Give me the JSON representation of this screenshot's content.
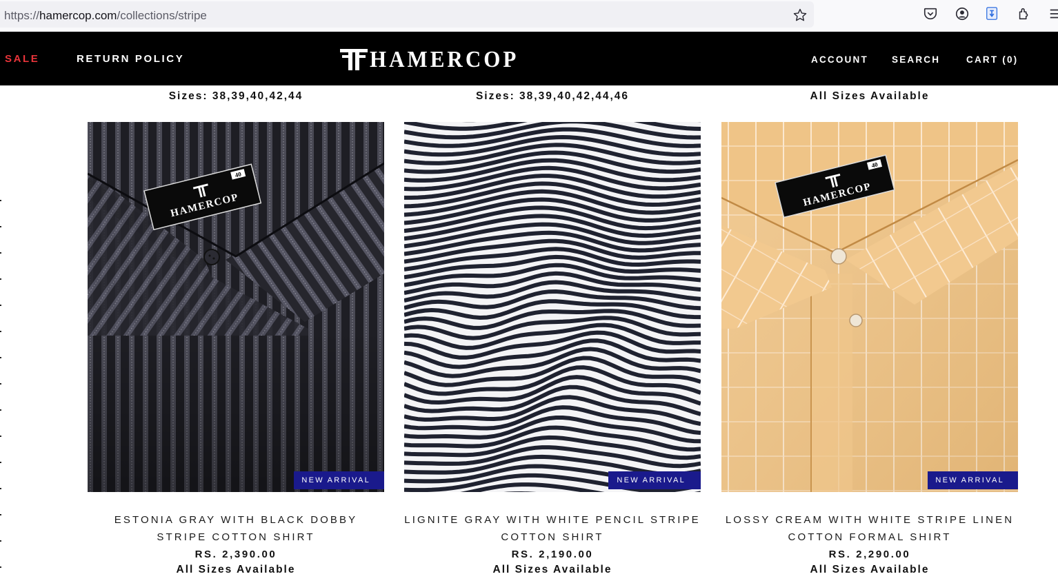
{
  "browser": {
    "url_scheme": "https://",
    "url_host": "hamercop.com",
    "url_path": "/collections/stripe",
    "icons": [
      "star-icon",
      "pocket-icon",
      "account-icon",
      "translate-icon",
      "extensions-icon",
      "menu-icon"
    ]
  },
  "header": {
    "nav_left": [
      {
        "label": "SALE",
        "color": "#e8343a"
      },
      {
        "label": "RETURN POLICY"
      }
    ],
    "logo_text": "HAMERCOP",
    "nav_right": [
      {
        "label": "ACCOUNT"
      },
      {
        "label": "SEARCH"
      },
      {
        "label": "CART (0)"
      }
    ],
    "background": "#000000"
  },
  "previous_row": {
    "sizes": [
      "Sizes: 38,39,40,42,44",
      "Sizes: 38,39,40,42,44,46",
      "All Sizes Available"
    ]
  },
  "products": [
    {
      "image": "charcoal-dobby-stripe-shirt-collar",
      "badge": "NEW ARRIVAL",
      "title": "ESTONIA GRAY WITH BLACK DOBBY STRIPE COTTON SHIRT",
      "price": "RS. 2,390.00",
      "sizes": "All Sizes Available"
    },
    {
      "image": "white-black-pencil-stripe-fabric-wave",
      "badge": "NEW ARRIVAL",
      "title": "LIGNITE GRAY WITH WHITE PENCIL STRIPE COTTON SHIRT",
      "price": "RS. 2,190.00",
      "sizes": "All Sizes Available"
    },
    {
      "image": "cream-linen-white-stripe-shirt-collar",
      "badge": "NEW ARRIVAL",
      "title": "LOSSY CREAM WITH WHITE STRIPE LINEN COTTON FORMAL SHIRT",
      "price": "RS. 2,290.00",
      "sizes": "All Sizes Available"
    }
  ],
  "colors": {
    "badge_bg": "#1a1a8c",
    "sale": "#e8343a"
  },
  "shirt_label": {
    "brand": "HAMERCOP",
    "size": "40"
  }
}
